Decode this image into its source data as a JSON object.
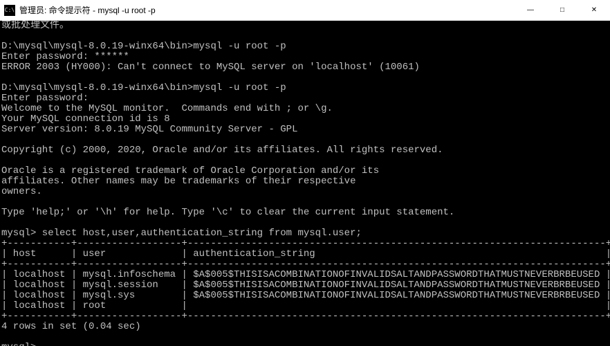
{
  "title": "管理员: 命令提示符 - mysql  -u root -p",
  "icon_text": "C:\\",
  "win_buttons": {
    "min": "—",
    "max": "□",
    "close": "✕"
  },
  "lines": [
    "或批处理文件。",
    "",
    "D:\\mysql\\mysql-8.0.19-winx64\\bin>mysql -u root -p",
    "Enter password: ******",
    "ERROR 2003 (HY000): Can't connect to MySQL server on 'localhost' (10061)",
    "",
    "D:\\mysql\\mysql-8.0.19-winx64\\bin>mysql -u root -p",
    "Enter password:",
    "Welcome to the MySQL monitor.  Commands end with ; or \\g.",
    "Your MySQL connection id is 8",
    "Server version: 8.0.19 MySQL Community Server - GPL",
    "",
    "Copyright (c) 2000, 2020, Oracle and/or its affiliates. All rights reserved.",
    "",
    "Oracle is a registered trademark of Oracle Corporation and/or its",
    "affiliates. Other names may be trademarks of their respective",
    "owners.",
    "",
    "Type 'help;' or '\\h' for help. Type '\\c' to clear the current input statement.",
    "",
    "mysql> select host,user,authentication_string from mysql.user;"
  ],
  "table": {
    "sep": "+-----------+------------------+------------------------------------------------------------------------+",
    "header": "| host      | user             | authentication_string                                                  |",
    "rows": [
      "| localhost | mysql.infoschema | $A$005$THISISACOMBINATIONOFINVALIDSALTANDPASSWORDTHATMUSTNEVERBRBEUSED |",
      "| localhost | mysql.session    | $A$005$THISISACOMBINATIONOFINVALIDSALTANDPASSWORDTHATMUSTNEVERBRBEUSED |",
      "| localhost | mysql.sys        | $A$005$THISISACOMBINATIONOFINVALIDSALTANDPASSWORDTHATMUSTNEVERBRBEUSED |",
      "| localhost | root             |                                                                        |"
    ]
  },
  "footer": [
    "4 rows in set (0.04 sec)",
    "",
    "mysql>"
  ],
  "raw_table": {
    "columns": [
      "host",
      "user",
      "authentication_string"
    ],
    "data": [
      [
        "localhost",
        "mysql.infoschema",
        "$A$005$THISISACOMBINATIONOFINVALIDSALTANDPASSWORDTHATMUSTNEVERBRBEUSED"
      ],
      [
        "localhost",
        "mysql.session",
        "$A$005$THISISACOMBINATIONOFINVALIDSALTANDPASSWORDTHATMUSTNEVERBRBEUSED"
      ],
      [
        "localhost",
        "mysql.sys",
        "$A$005$THISISACOMBINATIONOFINVALIDSALTANDPASSWORDTHATMUSTNEVERBRBEUSED"
      ],
      [
        "localhost",
        "root",
        ""
      ]
    ],
    "rows_in_set": 4,
    "elapsed_sec": 0.04
  }
}
